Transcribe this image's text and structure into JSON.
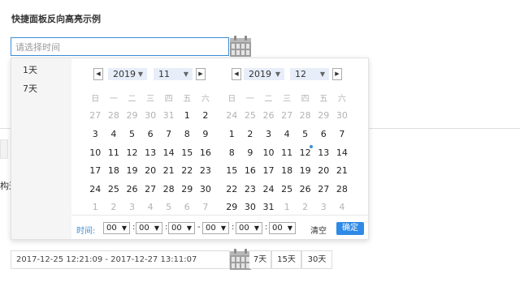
{
  "title": "快捷面板反向高亮示例",
  "main_input": {
    "placeholder": "请选择时间",
    "value": ""
  },
  "background": {
    "partial_text": "构造"
  },
  "shortcuts": [
    {
      "label": "1天"
    },
    {
      "label": "7天"
    }
  ],
  "weekdays": [
    "日",
    "一",
    "二",
    "三",
    "四",
    "五",
    "六"
  ],
  "left_calendar": {
    "year": "2019",
    "month": "11",
    "prev_icon": "triangle-left",
    "next_icon": "triangle-right",
    "weeks": [
      [
        "27",
        "28",
        "29",
        "30",
        "31",
        "1",
        "2"
      ],
      [
        "3",
        "4",
        "5",
        "6",
        "7",
        "8",
        "9"
      ],
      [
        "10",
        "11",
        "12",
        "13",
        "14",
        "15",
        "16"
      ],
      [
        "17",
        "18",
        "19",
        "20",
        "21",
        "22",
        "23"
      ],
      [
        "24",
        "25",
        "26",
        "27",
        "28",
        "29",
        "30"
      ],
      [
        "1",
        "2",
        "3",
        "4",
        "5",
        "6",
        "7"
      ]
    ],
    "other_month": [
      [
        true,
        true,
        true,
        true,
        true,
        false,
        false
      ],
      [
        false,
        false,
        false,
        false,
        false,
        false,
        false
      ],
      [
        false,
        false,
        false,
        false,
        false,
        false,
        false
      ],
      [
        false,
        false,
        false,
        false,
        false,
        false,
        false
      ],
      [
        false,
        false,
        false,
        false,
        false,
        false,
        false
      ],
      [
        true,
        true,
        true,
        true,
        true,
        true,
        true
      ]
    ]
  },
  "right_calendar": {
    "year": "2019",
    "month": "12",
    "prev_icon": "triangle-left",
    "next_icon": "triangle-right",
    "weeks": [
      [
        "24",
        "25",
        "26",
        "27",
        "28",
        "29",
        "30"
      ],
      [
        "1",
        "2",
        "3",
        "4",
        "5",
        "6",
        "7"
      ],
      [
        "8",
        "9",
        "10",
        "11",
        "12",
        "13",
        "14"
      ],
      [
        "15",
        "16",
        "17",
        "18",
        "19",
        "20",
        "21"
      ],
      [
        "22",
        "23",
        "24",
        "25",
        "26",
        "27",
        "28"
      ],
      [
        "29",
        "30",
        "31",
        "1",
        "2",
        "3",
        "4"
      ]
    ],
    "other_month": [
      [
        true,
        true,
        true,
        true,
        true,
        true,
        true
      ],
      [
        false,
        false,
        false,
        false,
        false,
        false,
        false
      ],
      [
        false,
        false,
        false,
        false,
        false,
        false,
        false
      ],
      [
        false,
        false,
        false,
        false,
        false,
        false,
        false
      ],
      [
        false,
        false,
        false,
        false,
        false,
        false,
        false
      ],
      [
        false,
        false,
        false,
        true,
        true,
        true,
        true
      ]
    ],
    "today": "12"
  },
  "time": {
    "label": "时间:",
    "start": [
      "00",
      "00",
      "00"
    ],
    "end": [
      "00",
      "00",
      "00"
    ],
    "colon": ":",
    "dash": "-"
  },
  "buttons": {
    "clear": "清空",
    "confirm": "确定"
  },
  "range_input": {
    "value": "2017-12-25 12:21:09 - 2017-12-27 13:11:07"
  },
  "quick_buttons": [
    "7天",
    "15天",
    "30天"
  ],
  "colors": {
    "accent": "#2e8ae6",
    "focus_border": "#3b8cd8",
    "select_bg": "#e7eef9",
    "muted": "#b3b3b3"
  }
}
